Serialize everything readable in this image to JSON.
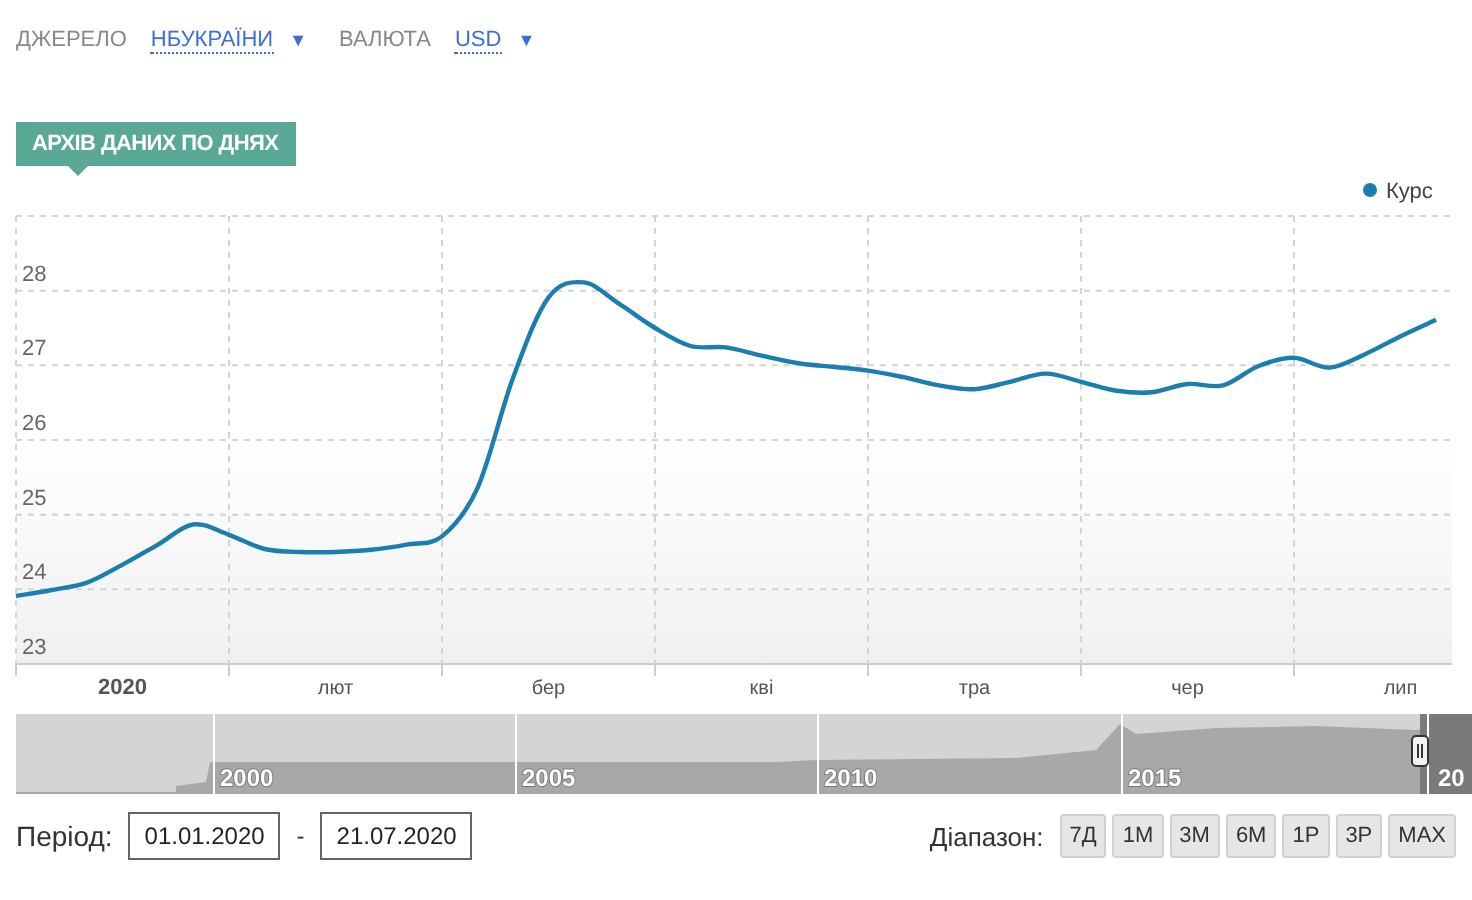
{
  "filters": [
    {
      "label": "ДЖЕРЕЛО",
      "value": "НБУКРАЇНИ",
      "caret": "▼"
    },
    {
      "label": "ВАЛЮТА",
      "value": "USD",
      "caret": "▼"
    }
  ],
  "section_tag": "АРХІВ ДАНИХ ПО ДНЯХ",
  "chart": {
    "chart_data": {
      "type": "line",
      "categories": [
        null,
        null,
        null,
        "2020",
        null,
        null,
        null,
        null,
        null,
        "лют",
        null,
        null,
        null,
        null,
        null,
        "бер",
        null,
        null,
        null,
        null,
        null,
        "кві",
        null,
        null,
        null,
        null,
        null,
        "тра",
        null,
        null,
        null,
        null,
        null,
        "чер",
        null,
        null,
        null,
        null,
        null,
        "лип",
        null
      ],
      "ylim": [
        23,
        29
      ],
      "grid": true,
      "yticks": [
        23,
        24,
        25,
        26,
        27,
        28
      ],
      "series": [
        {
          "name": "Курс",
          "color": "#1a7fae",
          "values": [
            23.91,
            23.99,
            24.09,
            24.33,
            24.6,
            24.87,
            24.73,
            24.54,
            24.5,
            24.5,
            24.53,
            24.6,
            24.71,
            25.36,
            26.83,
            27.91,
            28.11,
            27.82,
            27.5,
            27.26,
            27.24,
            27.13,
            27.03,
            26.98,
            26.93,
            26.84,
            26.73,
            26.68,
            26.78,
            26.89,
            26.78,
            26.66,
            26.64,
            26.75,
            26.73,
            26.99,
            27.1,
            26.97,
            27.15,
            27.39,
            27.61
          ]
        }
      ]
    }
  },
  "navigator": {
    "year_labels": [
      "2000",
      "2005",
      "2010",
      "2015",
      "20"
    ]
  },
  "period": {
    "label": "Період:",
    "from": "01.01.2020",
    "separator": "-",
    "to": "21.07.2020"
  },
  "range": {
    "label": "Діапазон:",
    "buttons": [
      "7Д",
      "1М",
      "3М",
      "6М",
      "1Р",
      "3Р",
      "MAX"
    ]
  }
}
